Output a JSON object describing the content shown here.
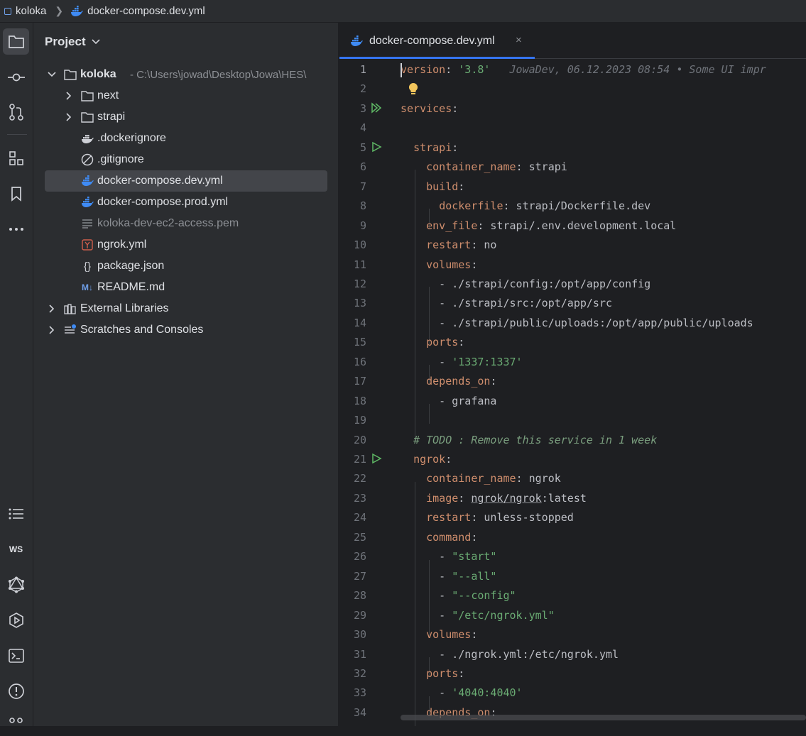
{
  "breadcrumb": {
    "project": "koloka",
    "file": "docker-compose.dev.yml"
  },
  "project_panel": {
    "title": "Project",
    "root": {
      "name": "koloka",
      "path": "- C:\\Users\\jowad\\Desktop\\Jowa\\HES\\"
    },
    "items": [
      {
        "label": "next",
        "icon": "folder-icon"
      },
      {
        "label": "strapi",
        "icon": "folder-icon"
      },
      {
        "label": ".dockerignore",
        "icon": "docker-ignore-icon"
      },
      {
        "label": ".gitignore",
        "icon": "gitignore-icon"
      },
      {
        "label": "docker-compose.dev.yml",
        "icon": "docker-icon",
        "selected": true
      },
      {
        "label": "docker-compose.prod.yml",
        "icon": "docker-icon"
      },
      {
        "label": "koloka-dev-ec2-access.pem",
        "icon": "text-file-icon"
      },
      {
        "label": "ngrok.yml",
        "icon": "yaml-icon"
      },
      {
        "label": "package.json",
        "icon": "json-icon"
      },
      {
        "label": "README.md",
        "icon": "markdown-icon"
      },
      {
        "label": "External Libraries",
        "icon": "library-icon"
      },
      {
        "label": "Scratches and Consoles",
        "icon": "scratches-icon"
      }
    ]
  },
  "editor": {
    "tab_label": "docker-compose.dev.yml",
    "close_glyph": "×",
    "blame": "JowaDev, 06.12.2023 08:54 • Some UI impr",
    "lines": [
      {
        "n": "1",
        "p": [
          [
            "version",
            "k"
          ],
          [
            ": ",
            ""
          ],
          [
            "'3.8'",
            "s"
          ]
        ]
      },
      {
        "n": "2",
        "p": []
      },
      {
        "n": "3",
        "p": [
          [
            "services",
            "k"
          ],
          [
            ":",
            ""
          ]
        ]
      },
      {
        "n": "4",
        "p": []
      },
      {
        "n": "5",
        "p": [
          [
            "  ",
            ""
          ],
          [
            "strapi",
            "k"
          ],
          [
            ":",
            ""
          ]
        ]
      },
      {
        "n": "6",
        "p": [
          [
            "    ",
            ""
          ],
          [
            "container_name",
            "k"
          ],
          [
            ": strapi",
            ""
          ]
        ]
      },
      {
        "n": "7",
        "p": [
          [
            "    ",
            ""
          ],
          [
            "build",
            "k"
          ],
          [
            ":",
            ""
          ]
        ]
      },
      {
        "n": "8",
        "p": [
          [
            "      ",
            ""
          ],
          [
            "dockerfile",
            "k"
          ],
          [
            ": strapi/Dockerfile.dev",
            ""
          ]
        ]
      },
      {
        "n": "9",
        "p": [
          [
            "    ",
            ""
          ],
          [
            "env_file",
            "k"
          ],
          [
            ": strapi/.env.development.local",
            ""
          ]
        ]
      },
      {
        "n": "10",
        "p": [
          [
            "    ",
            ""
          ],
          [
            "restart",
            "k"
          ],
          [
            ": no",
            ""
          ]
        ]
      },
      {
        "n": "11",
        "p": [
          [
            "    ",
            ""
          ],
          [
            "volumes",
            "k"
          ],
          [
            ":",
            ""
          ]
        ]
      },
      {
        "n": "12",
        "p": [
          [
            "      - ./strapi/config:/opt/app/config",
            ""
          ]
        ]
      },
      {
        "n": "13",
        "p": [
          [
            "      - ./strapi/src:/opt/app/src",
            ""
          ]
        ]
      },
      {
        "n": "14",
        "p": [
          [
            "      - ./strapi/public/uploads:/opt/app/public/uploads",
            ""
          ]
        ]
      },
      {
        "n": "15",
        "p": [
          [
            "    ",
            ""
          ],
          [
            "ports",
            "k"
          ],
          [
            ":",
            ""
          ]
        ]
      },
      {
        "n": "16",
        "p": [
          [
            "      - ",
            ""
          ],
          [
            "'1337:1337'",
            "s"
          ]
        ]
      },
      {
        "n": "17",
        "p": [
          [
            "    ",
            ""
          ],
          [
            "depends_on",
            "k"
          ],
          [
            ":",
            ""
          ]
        ]
      },
      {
        "n": "18",
        "p": [
          [
            "      - grafana",
            ""
          ]
        ]
      },
      {
        "n": "19",
        "p": []
      },
      {
        "n": "20",
        "p": [
          [
            "  ",
            ""
          ],
          [
            "# TODO : Remove this service in 1 week",
            "cmt"
          ]
        ]
      },
      {
        "n": "21",
        "p": [
          [
            "  ",
            ""
          ],
          [
            "ngrok",
            "k"
          ],
          [
            ":",
            ""
          ]
        ]
      },
      {
        "n": "22",
        "p": [
          [
            "    ",
            ""
          ],
          [
            "container_name",
            "k"
          ],
          [
            ": ngrok",
            ""
          ]
        ]
      },
      {
        "n": "23",
        "p": [
          [
            "    ",
            ""
          ],
          [
            "image",
            "k"
          ],
          [
            ": ",
            ""
          ],
          [
            "ngrok/ngrok",
            "u"
          ],
          [
            ":latest",
            ""
          ]
        ]
      },
      {
        "n": "24",
        "p": [
          [
            "    ",
            ""
          ],
          [
            "restart",
            "k"
          ],
          [
            ": unless-stopped",
            ""
          ]
        ]
      },
      {
        "n": "25",
        "p": [
          [
            "    ",
            ""
          ],
          [
            "command",
            "k"
          ],
          [
            ":",
            ""
          ]
        ]
      },
      {
        "n": "26",
        "p": [
          [
            "      - ",
            ""
          ],
          [
            "\"start\"",
            "s"
          ]
        ]
      },
      {
        "n": "27",
        "p": [
          [
            "      - ",
            ""
          ],
          [
            "\"--all\"",
            "s"
          ]
        ]
      },
      {
        "n": "28",
        "p": [
          [
            "      - ",
            ""
          ],
          [
            "\"--config\"",
            "s"
          ]
        ]
      },
      {
        "n": "29",
        "p": [
          [
            "      - ",
            ""
          ],
          [
            "\"/etc/ngrok.yml\"",
            "s"
          ]
        ]
      },
      {
        "n": "30",
        "p": [
          [
            "    ",
            ""
          ],
          [
            "volumes",
            "k"
          ],
          [
            ":",
            ""
          ]
        ]
      },
      {
        "n": "31",
        "p": [
          [
            "      - ./ngrok.yml:/etc/ngrok.yml",
            ""
          ]
        ]
      },
      {
        "n": "32",
        "p": [
          [
            "    ",
            ""
          ],
          [
            "ports",
            "k"
          ],
          [
            ":",
            ""
          ]
        ]
      },
      {
        "n": "33",
        "p": [
          [
            "      - ",
            ""
          ],
          [
            "'4040:4040'",
            "s"
          ]
        ]
      },
      {
        "n": "34",
        "p": [
          [
            "    ",
            ""
          ],
          [
            "depends_on",
            "k"
          ],
          [
            ":",
            ""
          ]
        ]
      }
    ],
    "run_markers": {
      "3": "run-all-icon",
      "5": "run-icon",
      "21": "run-icon"
    },
    "bulb_line": "2"
  },
  "colors": {
    "keyword": "#cf8e6d",
    "string": "#6aab73",
    "comment": "#7a9e7e",
    "accent": "#3574f0",
    "docker": "#3f8bf5"
  }
}
